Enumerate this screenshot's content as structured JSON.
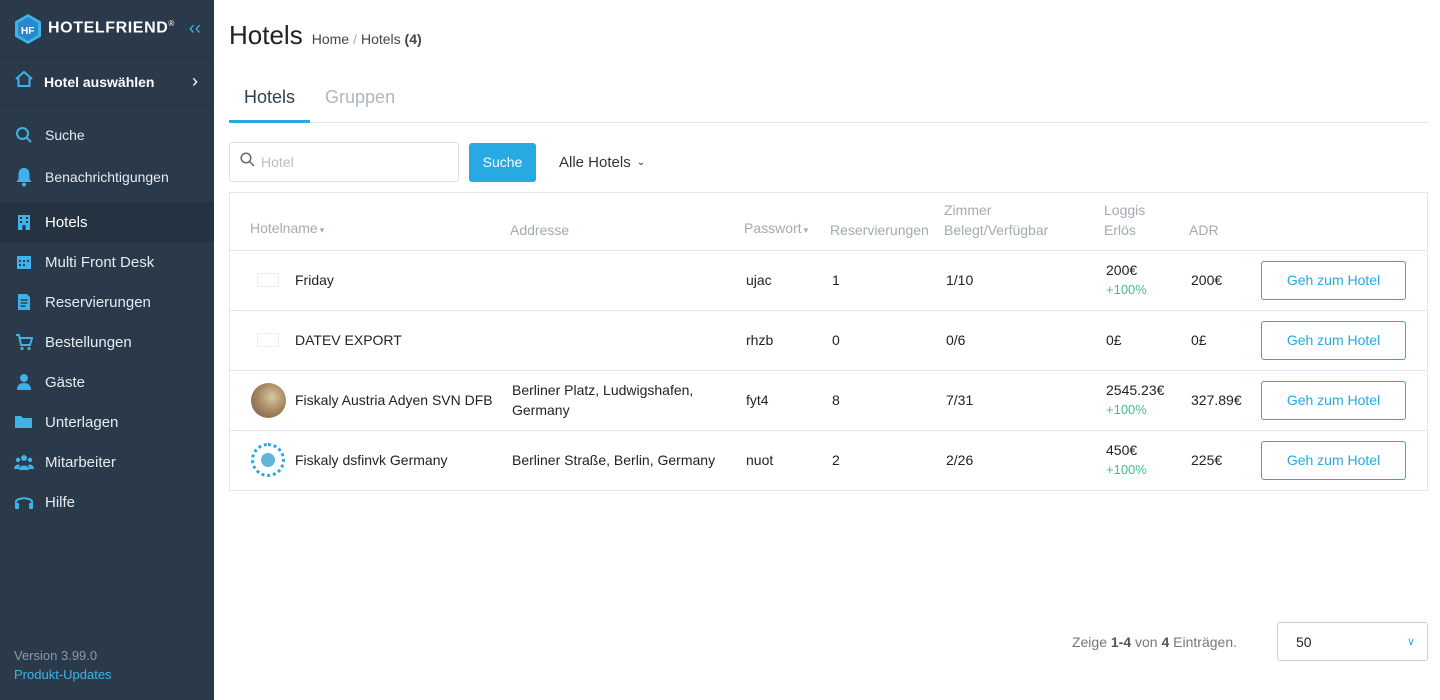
{
  "app": {
    "brand": "HOTELFRIEND",
    "brand_mark": "®",
    "hotel_select_label": "Hotel auswählen"
  },
  "sidebar": {
    "items": [
      {
        "label": "Suche",
        "icon": "search-icon"
      },
      {
        "label": "Benachrichtigungen",
        "icon": "bell-icon"
      },
      {
        "label": "Hotels",
        "icon": "hotel-building-icon",
        "active": true
      },
      {
        "label": "Multi Front Desk",
        "icon": "calendar-icon"
      },
      {
        "label": "Reservierungen",
        "icon": "document-icon"
      },
      {
        "label": "Bestellungen",
        "icon": "cart-icon"
      },
      {
        "label": "Gäste",
        "icon": "person-icon"
      },
      {
        "label": "Unterlagen",
        "icon": "folder-icon"
      },
      {
        "label": "Mitarbeiter",
        "icon": "team-icon"
      },
      {
        "label": "Hilfe",
        "icon": "headset-icon"
      }
    ],
    "version": "Version 3.99.0",
    "updates_link": "Produkt-Updates"
  },
  "header": {
    "title": "Hotels",
    "breadcrumb": {
      "home": "Home",
      "current": "Hotels",
      "count": "(4)"
    }
  },
  "tabs": [
    {
      "label": "Hotels",
      "active": true
    },
    {
      "label": "Gruppen",
      "active": false
    }
  ],
  "search": {
    "placeholder": "Hotel",
    "value": "",
    "button": "Suche",
    "filter": "Alle Hotels"
  },
  "table": {
    "columns": {
      "name": "Hotelname",
      "address": "Addresse",
      "password": "Passwort",
      "reservations": "Reservierungen",
      "rooms_line1": "Zimmer",
      "rooms_line2": "Belegt/Verfügbar",
      "revenue_line1": "Loggis",
      "revenue_line2": "Erlös",
      "adr": "ADR"
    },
    "rows": [
      {
        "name": "Friday",
        "address": "",
        "password": "ujac",
        "reservations": "1",
        "rooms": "1/10",
        "revenue": "200€",
        "revenue_change": "+100%",
        "adr": "200€",
        "action": "Geh zum Hotel"
      },
      {
        "name": "DATEV EXPORT",
        "address": "",
        "password": "rhzb",
        "reservations": "0",
        "rooms": "0/6",
        "revenue": "0£",
        "revenue_change": "",
        "adr": "0£",
        "action": "Geh zum Hotel"
      },
      {
        "name": "Fiskaly Austria Adyen SVN DFB",
        "address": "Berliner Platz, Ludwigshafen, Germany",
        "password": "fyt4",
        "reservations": "8",
        "rooms": "7/31",
        "revenue": "2545.23€",
        "revenue_change": "+100%",
        "adr": "327.89€",
        "action": "Geh zum Hotel"
      },
      {
        "name": "Fiskaly dsfinvk Germany",
        "address": "Berliner Straße, Berlin, Germany",
        "password": "nuot",
        "reservations": "2",
        "rooms": "2/26",
        "revenue": "450€",
        "revenue_change": "+100%",
        "adr": "225€",
        "action": "Geh zum Hotel"
      }
    ]
  },
  "pagination": {
    "prefix": "Zeige",
    "range": "1-4",
    "of": "von",
    "total": "4",
    "suffix": "Einträgen.",
    "page_size": "50"
  },
  "colors": {
    "sidebar_bg": "#2b3a4a",
    "accent": "#27a9e1",
    "positive": "#3fbf8f"
  }
}
